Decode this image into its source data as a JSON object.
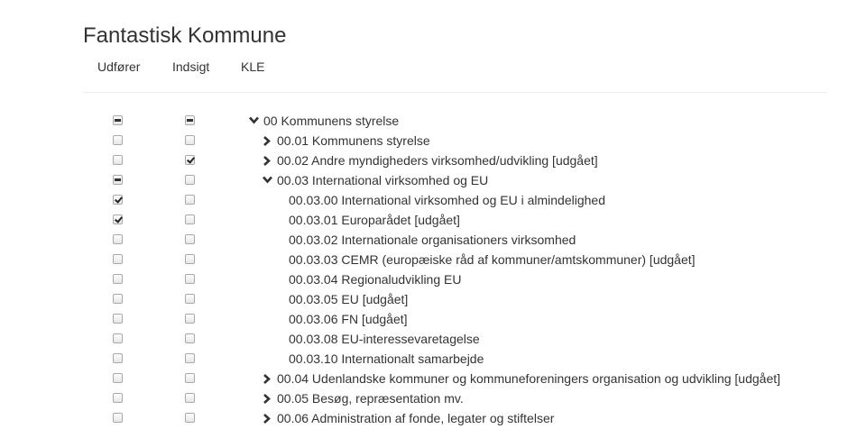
{
  "app": {
    "title": "Fantastisk Kommune"
  },
  "columns": [
    "Udfører",
    "Indsigt",
    "KLE"
  ],
  "tree": {
    "rows": [
      {
        "label": "00 Kommunens styrelse",
        "level": 0,
        "toggle": "expanded",
        "udforer": "indeterminate",
        "indsigt": "indeterminate"
      },
      {
        "label": "00.01 Kommunens styrelse",
        "level": 1,
        "toggle": "collapsed",
        "udforer": "unchecked",
        "indsigt": "unchecked"
      },
      {
        "label": "00.02 Andre myndigheders virksomhed/udvikling [udgået]",
        "level": 1,
        "toggle": "collapsed",
        "udforer": "unchecked",
        "indsigt": "checked"
      },
      {
        "label": "00.03 International virksomhed og EU",
        "level": 1,
        "toggle": "expanded",
        "udforer": "indeterminate",
        "indsigt": "unchecked"
      },
      {
        "label": "00.03.00 International virksomhed og EU i almindelighed",
        "level": 2,
        "toggle": "none",
        "udforer": "checked",
        "indsigt": "unchecked"
      },
      {
        "label": "00.03.01 Europarådet [udgået]",
        "level": 2,
        "toggle": "none",
        "udforer": "checked",
        "indsigt": "unchecked"
      },
      {
        "label": "00.03.02 Internationale organisationers virksomhed",
        "level": 2,
        "toggle": "none",
        "udforer": "unchecked",
        "indsigt": "unchecked"
      },
      {
        "label": "00.03.03 CEMR (europæiske råd af kommuner/amtskommuner) [udgået]",
        "level": 2,
        "toggle": "none",
        "udforer": "unchecked",
        "indsigt": "unchecked"
      },
      {
        "label": "00.03.04 Regionaludvikling EU",
        "level": 2,
        "toggle": "none",
        "udforer": "unchecked",
        "indsigt": "unchecked"
      },
      {
        "label": "00.03.05 EU [udgået]",
        "level": 2,
        "toggle": "none",
        "udforer": "unchecked",
        "indsigt": "unchecked"
      },
      {
        "label": "00.03.06 FN [udgået]",
        "level": 2,
        "toggle": "none",
        "udforer": "unchecked",
        "indsigt": "unchecked"
      },
      {
        "label": "00.03.08 EU-interessevaretagelse",
        "level": 2,
        "toggle": "none",
        "udforer": "unchecked",
        "indsigt": "unchecked"
      },
      {
        "label": "00.03.10 Internationalt samarbejde",
        "level": 2,
        "toggle": "none",
        "udforer": "unchecked",
        "indsigt": "unchecked"
      },
      {
        "label": "00.04 Udenlandske kommuner og kommuneforeningers organisation og udvikling [udgået]",
        "level": 1,
        "toggle": "collapsed",
        "udforer": "unchecked",
        "indsigt": "unchecked"
      },
      {
        "label": "00.05 Besøg, repræsentation mv.",
        "level": 1,
        "toggle": "collapsed",
        "udforer": "unchecked",
        "indsigt": "unchecked"
      },
      {
        "label": "00.06 Administration af fonde, legater og stiftelser",
        "level": 1,
        "toggle": "collapsed",
        "udforer": "unchecked",
        "indsigt": "unchecked"
      }
    ]
  },
  "icons": {
    "expanded": "chevron-down-icon",
    "collapsed": "chevron-right-icon"
  },
  "colors": {
    "text": "#333333",
    "divider": "#eeeeee",
    "checkbox_border": "#a9a9a9"
  }
}
